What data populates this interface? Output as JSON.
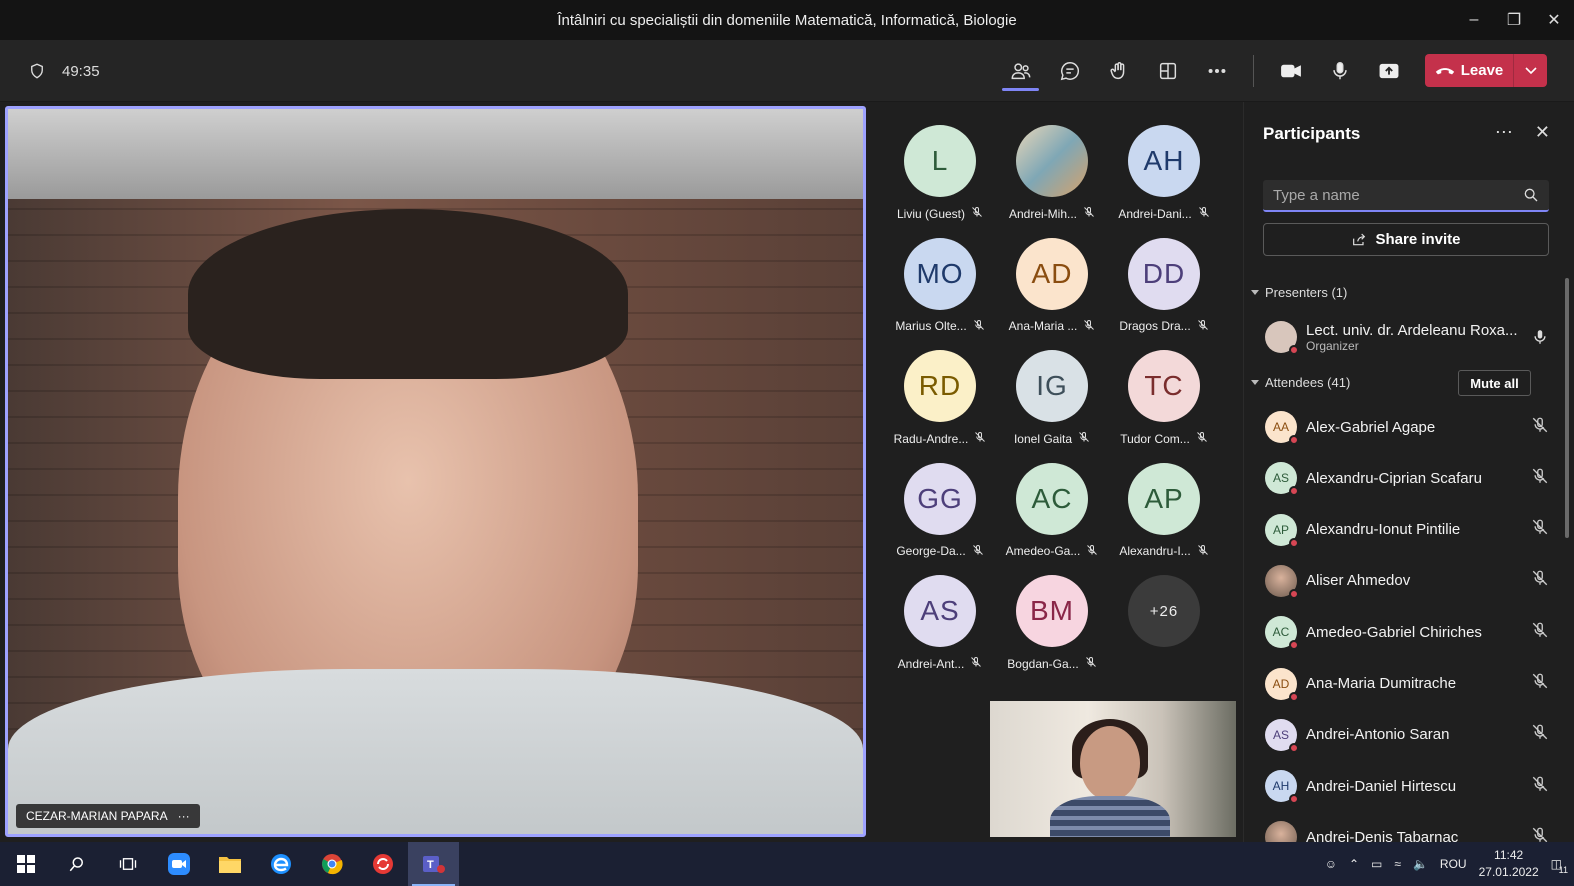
{
  "window": {
    "title": "Întâlniri cu specialiștii din domeniile Matematică, Informatică, Biologie",
    "controls": [
      "minimize",
      "restore",
      "close"
    ]
  },
  "toolbar": {
    "timer": "49:35",
    "leave_label": "Leave",
    "icons": [
      "participants-icon",
      "chat-icon",
      "reactions-icon",
      "rooms-icon",
      "more-icon",
      "camera-icon",
      "mic-icon",
      "share-icon"
    ]
  },
  "stage": {
    "speaker_name": "CEZAR-MARIAN PAPARA",
    "more": "···"
  },
  "gallery": [
    {
      "initials": "L",
      "name": "Liviu (Guest)",
      "bg": "#cfe8d6",
      "fg": "#2d5b3a"
    },
    {
      "initials": "",
      "name": "Andrei-Mih...",
      "bg": "#b9a38a",
      "fg": "#333",
      "photo": true
    },
    {
      "initials": "AH",
      "name": "Andrei-Dani...",
      "bg": "#c9d8f0",
      "fg": "#1f3a6b"
    },
    {
      "initials": "MO",
      "name": "Marius Olte...",
      "bg": "#c9d8f0",
      "fg": "#1f3a6b"
    },
    {
      "initials": "AD",
      "name": "Ana-Maria ...",
      "bg": "#fbe4cc",
      "fg": "#8a4d10"
    },
    {
      "initials": "DD",
      "name": "Dragos Dra...",
      "bg": "#e0dcf0",
      "fg": "#4d3f7a"
    },
    {
      "initials": "RD",
      "name": "Radu-Andre...",
      "bg": "#fbf0c8",
      "fg": "#7a5b00"
    },
    {
      "initials": "IG",
      "name": "Ionel Gaita",
      "bg": "#d9e1e6",
      "fg": "#3e4f5a"
    },
    {
      "initials": "TC",
      "name": "Tudor Com...",
      "bg": "#f3d9d9",
      "fg": "#7a2d2d"
    },
    {
      "initials": "GG",
      "name": "George-Da...",
      "bg": "#e0dcf0",
      "fg": "#4d3f7a"
    },
    {
      "initials": "AC",
      "name": "Amedeo-Ga...",
      "bg": "#cfe8d6",
      "fg": "#2d5b3a"
    },
    {
      "initials": "AP",
      "name": "Alexandru-I...",
      "bg": "#cfe8d6",
      "fg": "#2d5b3a"
    },
    {
      "initials": "AS",
      "name": "Andrei-Ant...",
      "bg": "#e0dcf0",
      "fg": "#4d3f7a"
    },
    {
      "initials": "BM",
      "name": "Bogdan-Ga...",
      "bg": "#f7d5e0",
      "fg": "#8a2648"
    },
    {
      "initials": "+26",
      "name": "",
      "bg": "#3b3b3b",
      "fg": "#eee",
      "overflow": true
    }
  ],
  "panel": {
    "title": "Participants",
    "search_placeholder": "Type a name",
    "share_invite": "Share invite",
    "presenters_label": "Presenters (1)",
    "presenter": {
      "name": "Lect. univ. dr. Ardeleanu Roxa...",
      "role": "Organizer"
    },
    "attendees_label": "Attendees (41)",
    "mute_all": "Mute all",
    "attendees": [
      {
        "initials": "AA",
        "name": "Alex-Gabriel Agape",
        "bg": "#fbe4cc",
        "fg": "#8a4d10"
      },
      {
        "initials": "AS",
        "name": "Alexandru-Ciprian Scafaru",
        "bg": "#cfe8d6",
        "fg": "#2d5b3a"
      },
      {
        "initials": "AP",
        "name": "Alexandru-Ionut Pintilie",
        "bg": "#cfe8d6",
        "fg": "#2d5b3a"
      },
      {
        "initials": "",
        "name": "Aliser Ahmedov",
        "bg": "#a8a095",
        "fg": "#333",
        "photo": true
      },
      {
        "initials": "AC",
        "name": "Amedeo-Gabriel Chiriches",
        "bg": "#cfe8d6",
        "fg": "#2d5b3a"
      },
      {
        "initials": "AD",
        "name": "Ana-Maria Dumitrache",
        "bg": "#fbe4cc",
        "fg": "#8a4d10"
      },
      {
        "initials": "AS",
        "name": "Andrei-Antonio Saran",
        "bg": "#e0dcf0",
        "fg": "#4d3f7a"
      },
      {
        "initials": "AH",
        "name": "Andrei-Daniel Hirtescu",
        "bg": "#c9d8f0",
        "fg": "#1f3a6b"
      },
      {
        "initials": "",
        "name": "Andrei-Denis Tabarnac",
        "bg": "#b59a86",
        "fg": "#333",
        "photo": true
      }
    ]
  },
  "taskbar": {
    "apps": [
      "start-icon",
      "search-icon",
      "task-view-icon",
      "zoom-icon",
      "file-explorer-icon",
      "edge-icon",
      "chrome-icon",
      "sync-app-icon",
      "teams-icon"
    ],
    "language": "ROU",
    "time": "11:42",
    "date": "27.01.2022",
    "notifications": "11"
  }
}
